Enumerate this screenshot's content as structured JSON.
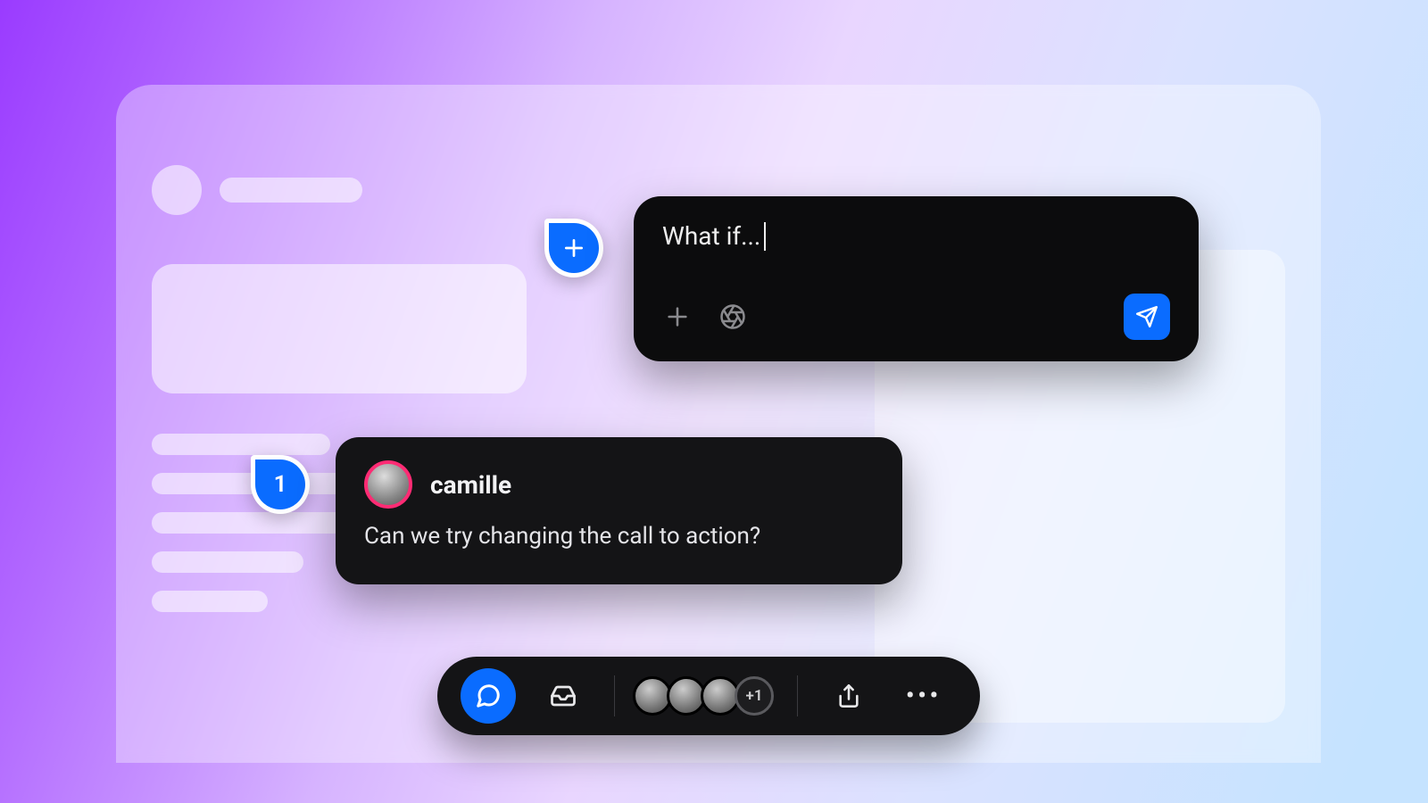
{
  "composer": {
    "draft_text": "What if...",
    "icons": {
      "add": "plus-icon",
      "aperture": "aperture-icon",
      "send": "send-icon"
    }
  },
  "pins": {
    "new_comment_glyph": "+",
    "thread_1_count": "1"
  },
  "comment": {
    "author": "camille",
    "body": "Can we try changing the call to action?"
  },
  "toolbar": {
    "presence_overflow": "+1",
    "presence_rings": [
      "#ffb300",
      "#0a6cff",
      "#ff2b74"
    ]
  }
}
